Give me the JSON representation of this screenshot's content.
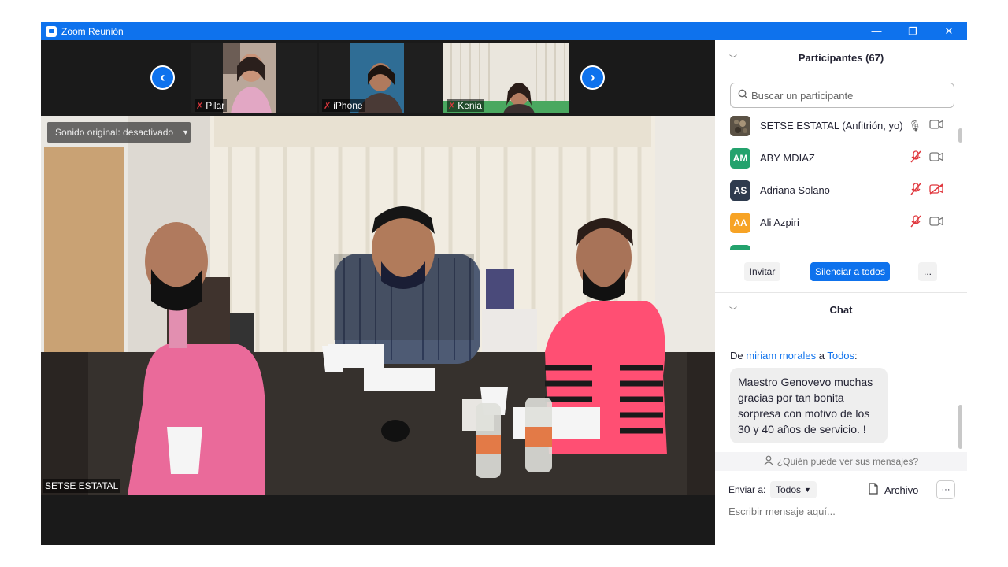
{
  "window": {
    "title": "Zoom Reunión",
    "minimize_glyph": "—",
    "restore_glyph": "❐",
    "close_glyph": "✕"
  },
  "thumbnails": [
    {
      "name": "Pilar"
    },
    {
      "name": "iPhone"
    },
    {
      "name": "Kenia"
    }
  ],
  "strip_nav": {
    "prev_glyph": "‹",
    "next_glyph": "›"
  },
  "main_video": {
    "sound_label": "Sonido original: desactivado",
    "speaker_name": "SETSE ESTATAL"
  },
  "participants": {
    "header": "Participantes (67)",
    "search_placeholder": "Buscar un participante",
    "list": [
      {
        "name": "SETSE ESTATAL (Anfitrión, yo)",
        "avatar": "",
        "avatar_color": "#5b5245",
        "mic_muted": false,
        "video_off": false
      },
      {
        "name": "ABY MDIAZ",
        "avatar": "AM",
        "avatar_color": "#23a26d",
        "mic_muted": true,
        "video_off": false
      },
      {
        "name": "Adriana Solano",
        "avatar": "AS",
        "avatar_color": "#2e3b4e",
        "mic_muted": true,
        "video_off": true
      },
      {
        "name": "Ali Azpiri",
        "avatar": "AA",
        "avatar_color": "#f7a325",
        "mic_muted": true,
        "video_off": false
      }
    ],
    "invite_label": "Invitar",
    "mute_all_label": "Silenciar a todos",
    "more_label": "..."
  },
  "chat": {
    "header": "Chat",
    "from_prefix": "De",
    "from_sender": "miriam morales",
    "from_to": "a",
    "from_recipient": "Todos",
    "from_suffix": ":",
    "message": "Maestro Genovevo muchas gracias por tan bonita sorpresa con motivo de los 30  y 40 años de servicio. !",
    "visibility_label": "¿Quién puede ver sus mensajes?",
    "send_to_label": "Enviar a:",
    "send_to_value": "Todos",
    "file_label": "Archivo",
    "more_label": "···",
    "input_placeholder": "Escribir mensaje aquí..."
  },
  "colors": {
    "accent": "#0e72ed",
    "muted": "#e0383e",
    "video_bg": "#1a1a1a"
  }
}
